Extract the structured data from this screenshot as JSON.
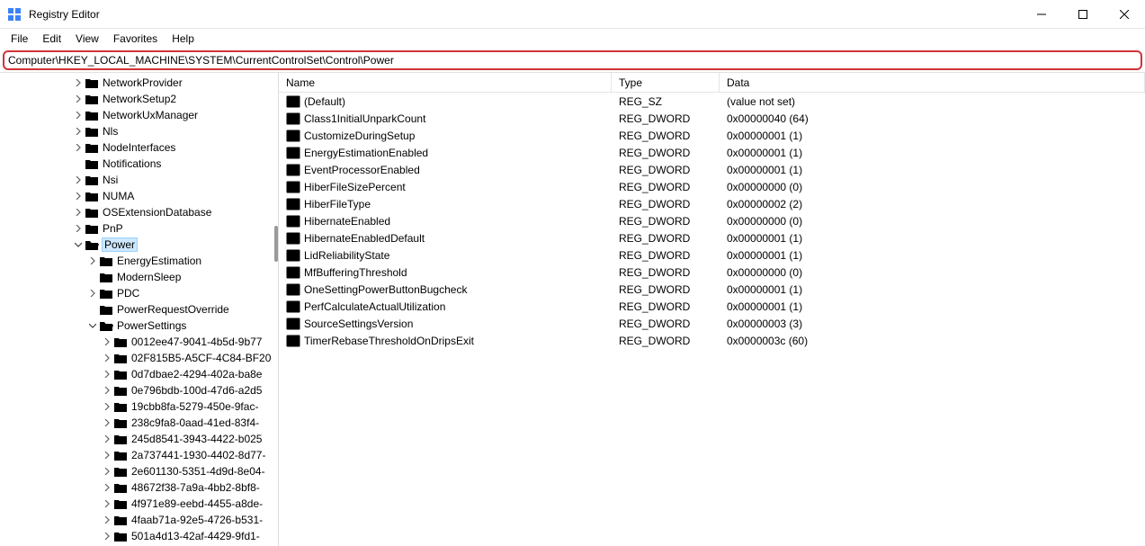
{
  "window": {
    "title": "Registry Editor"
  },
  "menu": {
    "file": "File",
    "edit": "Edit",
    "view": "View",
    "favorites": "Favorites",
    "help": "Help"
  },
  "address": "Computer\\HKEY_LOCAL_MACHINE\\SYSTEM\\CurrentControlSet\\Control\\Power",
  "columns": {
    "name": "Name",
    "type": "Type",
    "data": "Data"
  },
  "tree": [
    {
      "depth": 5,
      "exp": ">",
      "label": "NetworkProvider"
    },
    {
      "depth": 5,
      "exp": ">",
      "label": "NetworkSetup2"
    },
    {
      "depth": 5,
      "exp": ">",
      "label": "NetworkUxManager"
    },
    {
      "depth": 5,
      "exp": ">",
      "label": "Nls"
    },
    {
      "depth": 5,
      "exp": ">",
      "label": "NodeInterfaces"
    },
    {
      "depth": 5,
      "exp": "",
      "label": "Notifications"
    },
    {
      "depth": 5,
      "exp": ">",
      "label": "Nsi"
    },
    {
      "depth": 5,
      "exp": ">",
      "label": "NUMA"
    },
    {
      "depth": 5,
      "exp": ">",
      "label": "OSExtensionDatabase"
    },
    {
      "depth": 5,
      "exp": ">",
      "label": "PnP"
    },
    {
      "depth": 5,
      "exp": "v",
      "label": "Power",
      "open": true,
      "selected": true
    },
    {
      "depth": 6,
      "exp": ">",
      "label": "EnergyEstimation"
    },
    {
      "depth": 6,
      "exp": "",
      "label": "ModernSleep"
    },
    {
      "depth": 6,
      "exp": ">",
      "label": "PDC"
    },
    {
      "depth": 6,
      "exp": "",
      "label": "PowerRequestOverride"
    },
    {
      "depth": 6,
      "exp": "v",
      "label": "PowerSettings",
      "open": true
    },
    {
      "depth": 7,
      "exp": ">",
      "label": "0012ee47-9041-4b5d-9b77"
    },
    {
      "depth": 7,
      "exp": ">",
      "label": "02F815B5-A5CF-4C84-BF20"
    },
    {
      "depth": 7,
      "exp": ">",
      "label": "0d7dbae2-4294-402a-ba8e"
    },
    {
      "depth": 7,
      "exp": ">",
      "label": "0e796bdb-100d-47d6-a2d5"
    },
    {
      "depth": 7,
      "exp": ">",
      "label": "19cbb8fa-5279-450e-9fac-"
    },
    {
      "depth": 7,
      "exp": ">",
      "label": "238c9fa8-0aad-41ed-83f4-"
    },
    {
      "depth": 7,
      "exp": ">",
      "label": "245d8541-3943-4422-b025"
    },
    {
      "depth": 7,
      "exp": ">",
      "label": "2a737441-1930-4402-8d77-"
    },
    {
      "depth": 7,
      "exp": ">",
      "label": "2e601130-5351-4d9d-8e04-"
    },
    {
      "depth": 7,
      "exp": ">",
      "label": "48672f38-7a9a-4bb2-8bf8-"
    },
    {
      "depth": 7,
      "exp": ">",
      "label": "4f971e89-eebd-4455-a8de-"
    },
    {
      "depth": 7,
      "exp": ">",
      "label": "4faab71a-92e5-4726-b531-"
    },
    {
      "depth": 7,
      "exp": ">",
      "label": "501a4d13-42af-4429-9fd1-"
    }
  ],
  "values": [
    {
      "icon": "ab",
      "name": "(Default)",
      "type": "REG_SZ",
      "data": "(value not set)"
    },
    {
      "icon": "dw",
      "name": "Class1InitialUnparkCount",
      "type": "REG_DWORD",
      "data": "0x00000040 (64)"
    },
    {
      "icon": "dw",
      "name": "CustomizeDuringSetup",
      "type": "REG_DWORD",
      "data": "0x00000001 (1)"
    },
    {
      "icon": "dw",
      "name": "EnergyEstimationEnabled",
      "type": "REG_DWORD",
      "data": "0x00000001 (1)"
    },
    {
      "icon": "dw",
      "name": "EventProcessorEnabled",
      "type": "REG_DWORD",
      "data": "0x00000001 (1)"
    },
    {
      "icon": "dw",
      "name": "HiberFileSizePercent",
      "type": "REG_DWORD",
      "data": "0x00000000 (0)"
    },
    {
      "icon": "dw",
      "name": "HiberFileType",
      "type": "REG_DWORD",
      "data": "0x00000002 (2)"
    },
    {
      "icon": "dw",
      "name": "HibernateEnabled",
      "type": "REG_DWORD",
      "data": "0x00000000 (0)"
    },
    {
      "icon": "dw",
      "name": "HibernateEnabledDefault",
      "type": "REG_DWORD",
      "data": "0x00000001 (1)"
    },
    {
      "icon": "dw",
      "name": "LidReliabilityState",
      "type": "REG_DWORD",
      "data": "0x00000001 (1)"
    },
    {
      "icon": "dw",
      "name": "MfBufferingThreshold",
      "type": "REG_DWORD",
      "data": "0x00000000 (0)"
    },
    {
      "icon": "dw",
      "name": "OneSettingPowerButtonBugcheck",
      "type": "REG_DWORD",
      "data": "0x00000001 (1)"
    },
    {
      "icon": "dw",
      "name": "PerfCalculateActualUtilization",
      "type": "REG_DWORD",
      "data": "0x00000001 (1)"
    },
    {
      "icon": "dw",
      "name": "SourceSettingsVersion",
      "type": "REG_DWORD",
      "data": "0x00000003 (3)"
    },
    {
      "icon": "dw",
      "name": "TimerRebaseThresholdOnDripsExit",
      "type": "REG_DWORD",
      "data": "0x0000003c (60)"
    }
  ]
}
